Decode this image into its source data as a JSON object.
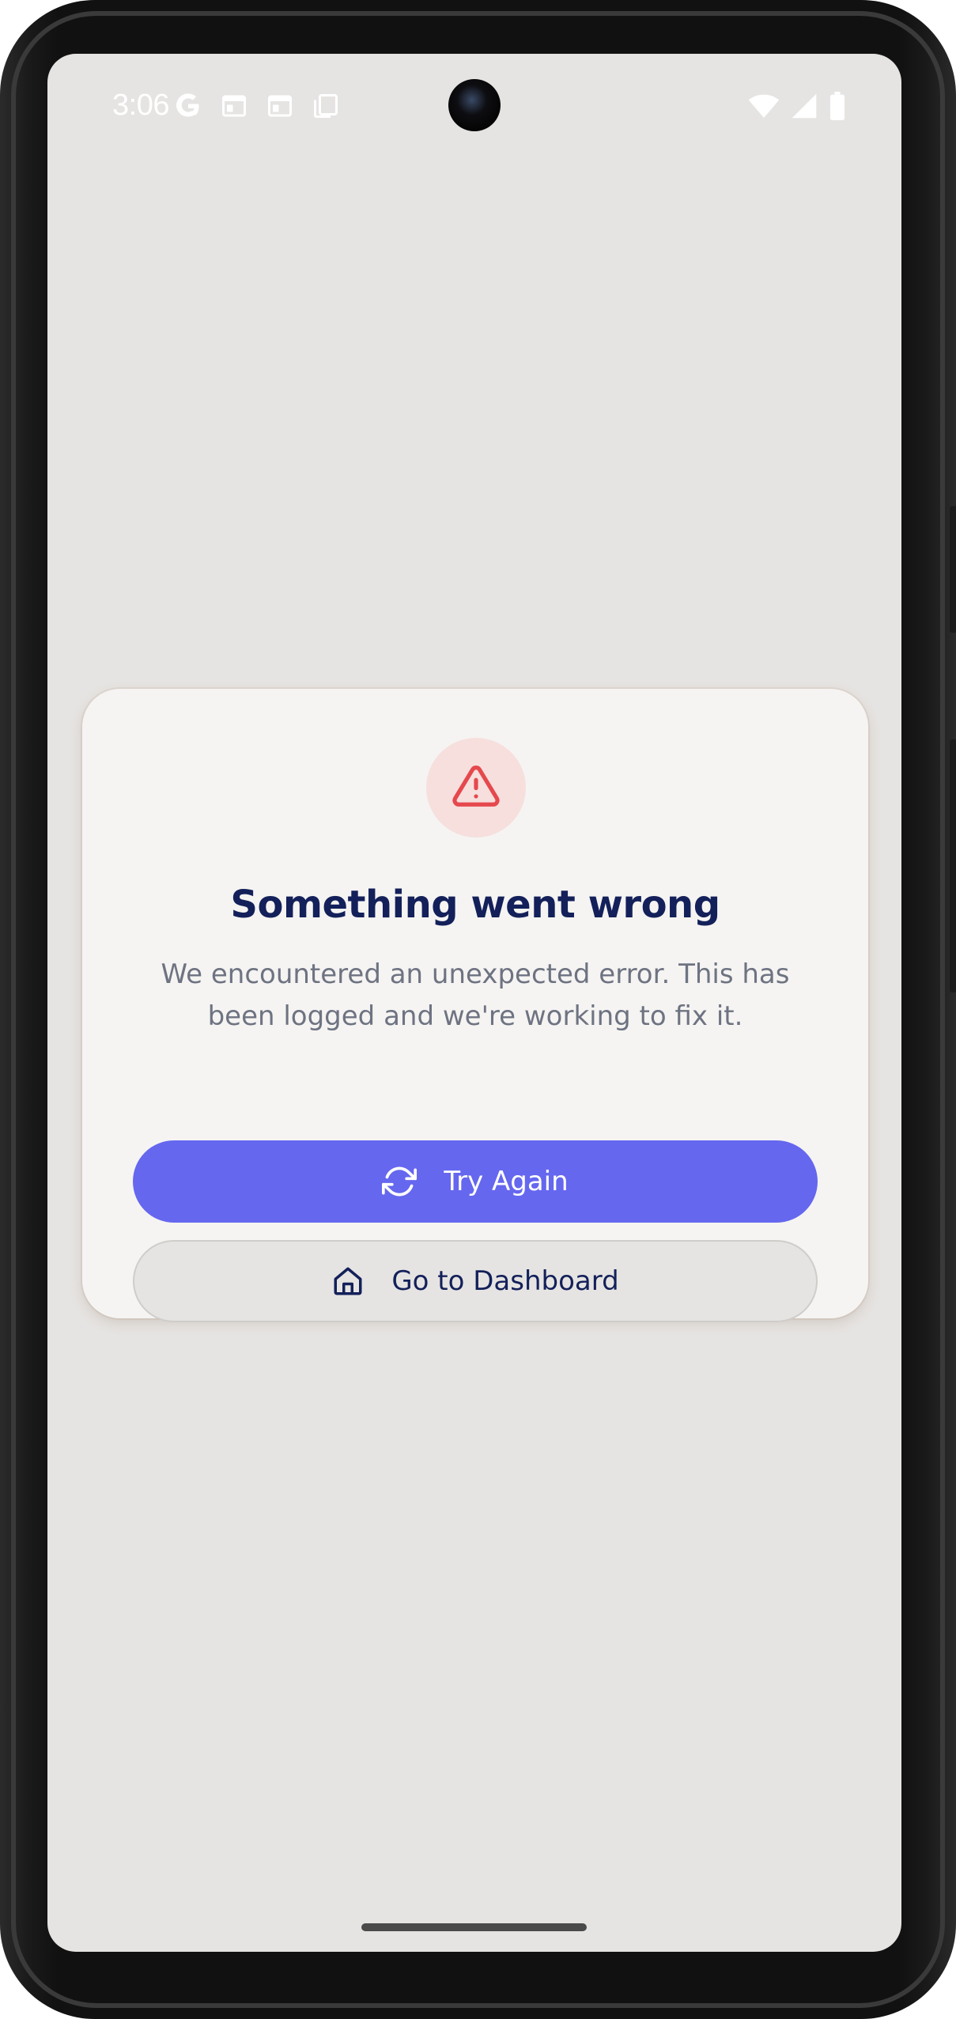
{
  "status_bar": {
    "time": "3:06",
    "left_icons": [
      "google-icon",
      "calendar-icon",
      "calendar-icon",
      "copy-icon"
    ],
    "right_icons": [
      "wifi-icon",
      "signal-icon",
      "battery-icon"
    ]
  },
  "error_card": {
    "icon": "warning-triangle-icon",
    "title": "Something went wrong",
    "message_line1": "We encountered an unexpected error. This has",
    "message_line2": "been logged and we're working to fix it.",
    "primary_button": {
      "icon": "refresh-icon",
      "label": "Try Again"
    },
    "secondary_button": {
      "icon": "home-icon",
      "label": "Go to Dashboard"
    }
  },
  "colors": {
    "primary": "#6567ef",
    "title": "#13205a",
    "error": "#e5484d",
    "error_bg": "#f6dfdd",
    "screen_bg": "#e6e4e2",
    "card_bg": "#f5f4f2"
  }
}
